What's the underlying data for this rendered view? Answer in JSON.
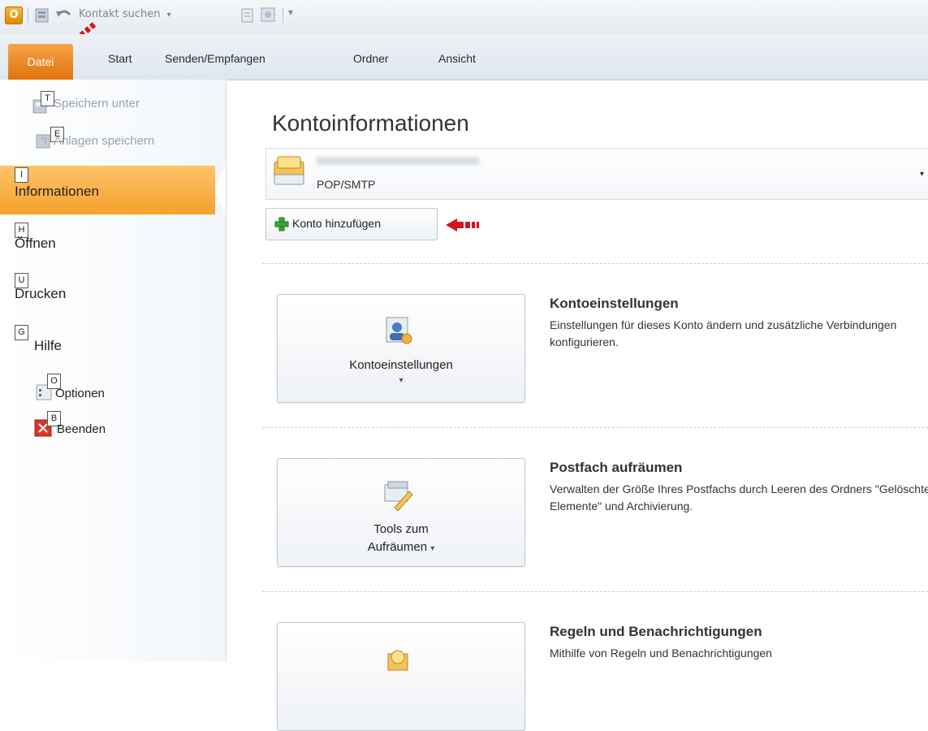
{
  "qat": {
    "app_icon": "O",
    "search_contact": "Kontakt suchen",
    "search_caret": "▾"
  },
  "ribbon": {
    "tabs": [
      "Datei",
      "Start",
      "Senden/Empfangen",
      "Ordner",
      "Ansicht"
    ]
  },
  "sidebar": {
    "items": [
      {
        "label": "Speichern unter",
        "keytip": "T",
        "icon": "save-as-icon",
        "disabled": true
      },
      {
        "label": "Anlagen speichern",
        "keytip": "E",
        "icon": "save-attachments-icon",
        "disabled": true
      },
      {
        "label": "Informationen",
        "keytip": "I",
        "active": true
      },
      {
        "label": "Öffnen",
        "keytip": "H"
      },
      {
        "label": "Drucken",
        "keytip": "U"
      },
      {
        "label": "Hilfe",
        "keytip": "G"
      },
      {
        "label": "Optionen",
        "keytip": "O",
        "icon": "options-icon"
      },
      {
        "label": "Beenden",
        "keytip": "B",
        "icon": "exit-icon"
      }
    ]
  },
  "main": {
    "title": "Kontoinformationen",
    "account": {
      "type": "POP/SMTP",
      "caret": "▾"
    },
    "add_account_label": "Konto hinzufügen",
    "sections": [
      {
        "button_label": "Kontoeinstellungen",
        "button_caret": "▾",
        "title": "Kontoeinstellungen",
        "description": "Einstellungen für dieses Konto ändern und zusätzliche Verbindungen konfigurieren.",
        "icon": "account-settings-icon"
      },
      {
        "button_label_line1": "Tools zum",
        "button_label_line2": "Aufräumen",
        "button_caret": "▾",
        "title": "Postfach aufräumen",
        "description": "Verwalten der Größe Ihres Postfachs durch Leeren des Ordners \"Gelöschte Elemente\" und Archivierung.",
        "icon": "cleanup-tools-icon"
      },
      {
        "title": "Regeln und Benachrichtigungen",
        "description": "Mithilfe von Regeln und Benachrichtigungen",
        "icon": "rules-icon"
      }
    ]
  },
  "colors": {
    "file_tab": "#e1720c",
    "active_item": "#f4a22b",
    "annotation_arrow": "#d8141b"
  }
}
